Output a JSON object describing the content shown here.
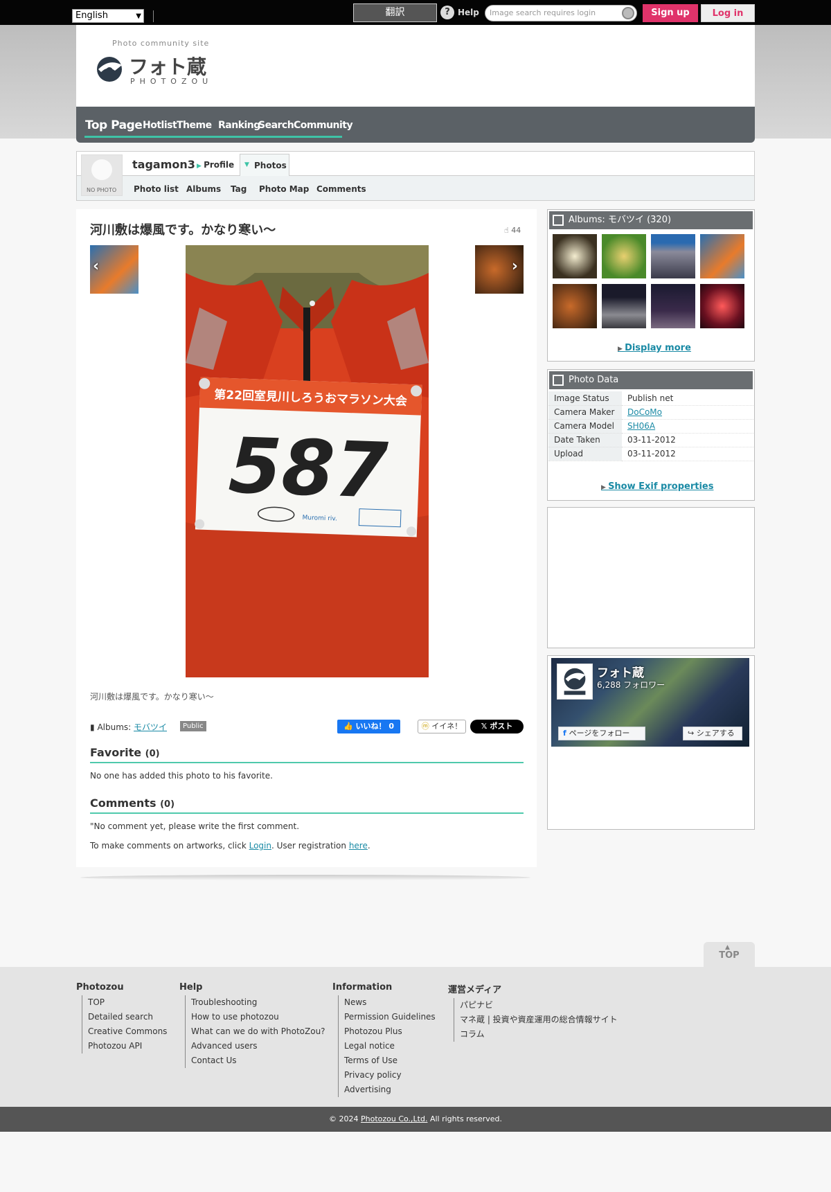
{
  "topbar": {
    "language": "English",
    "translate": "翻訳",
    "help": "Help",
    "search_placeholder": "Image search requires login",
    "signup": "Sign up",
    "login": "Log in"
  },
  "header": {
    "tagline": "Photo community site",
    "logo_jp": "フォト蔵",
    "logo_en": "PHOTOZOU",
    "nav": [
      "Top Page",
      "Hotlist",
      "Theme",
      "Ranking",
      "Search",
      "Community"
    ]
  },
  "user": {
    "no_photo": "NO PHOTO",
    "name": "tagamon3",
    "profile": "Profile",
    "photos": "Photos",
    "subnav": [
      "Photo list",
      "Albums",
      "Tag",
      "Photo Map",
      "Comments"
    ]
  },
  "photo": {
    "title": "河川敷は爆風です。かなり寒い〜",
    "views": "44",
    "bib_event": "第22回室見川しろうおマラソン大会",
    "bib_number": "587",
    "bib_brand": "Muromi riv.",
    "caption": "河川敷は爆風です。かなり寒い〜",
    "albums_label": "Albums:",
    "album_name": "モバツイ",
    "public_badge": "Public",
    "fb_like": "いいね！ 0",
    "mixi": "イイネ！",
    "x_post": "ポスト"
  },
  "favorite": {
    "heading": "Favorite",
    "count": "(0)",
    "text": "No one has added this photo to his favorite."
  },
  "comments": {
    "heading": "Comments",
    "count": "(0)",
    "text1": "\"No comment yet, please write the first comment.",
    "text2_pre": "To make comments on artworks, click ",
    "login_link": "Login",
    "text2_mid": ". User registration ",
    "here_link": "here",
    "text2_end": "."
  },
  "sidebar": {
    "albums_head": "Albums: モバツイ (320)",
    "display_more": "Display more",
    "photodata_head": "Photo Data",
    "photodata": [
      {
        "k": "Image Status",
        "v": "Publish net",
        "link": false
      },
      {
        "k": "Camera Maker",
        "v": "DoCoMo",
        "link": true
      },
      {
        "k": "Camera Model",
        "v": "SH06A",
        "link": true
      },
      {
        "k": "Date Taken",
        "v": "03-11-2012",
        "link": false
      },
      {
        "k": "Upload",
        "v": "03-11-2012",
        "link": false
      }
    ],
    "show_exif": "Show Exif properties",
    "fb_page_name": "フォト蔵",
    "fb_followers": "6,288 フォロワー",
    "fb_follow_btn": "ページをフォロー",
    "fb_share_btn": "シェアする"
  },
  "top_button": "TOP",
  "footer": {
    "cols": [
      {
        "head": "Photozou",
        "items": [
          "TOP",
          "Detailed search",
          "Creative Commons",
          "Photozou API"
        ]
      },
      {
        "head": "Help",
        "items": [
          "Troubleshooting",
          "How to use photozou",
          "What can we do with PhotoZou?",
          "Advanced users",
          "Contact Us"
        ]
      },
      {
        "head": "Information",
        "items": [
          "News",
          "Permission Guidelines",
          "Photozou Plus",
          "Legal notice",
          "Terms of Use",
          "Privacy policy",
          "Advertising"
        ]
      },
      {
        "head": "運営メディア",
        "items": [
          "パピナビ",
          "マネ蔵 | 投資や資産運用の総合情報サイト",
          "コラム"
        ]
      }
    ],
    "copy_pre": "© 2024 ",
    "copy_link": "Photozou Co.,Ltd.",
    "copy_post": " All rights reserved."
  },
  "colors": {
    "accent": "#3ec4a7",
    "signup": "#e0336a",
    "nav": "#5b6166",
    "link": "#1a8aa5"
  }
}
